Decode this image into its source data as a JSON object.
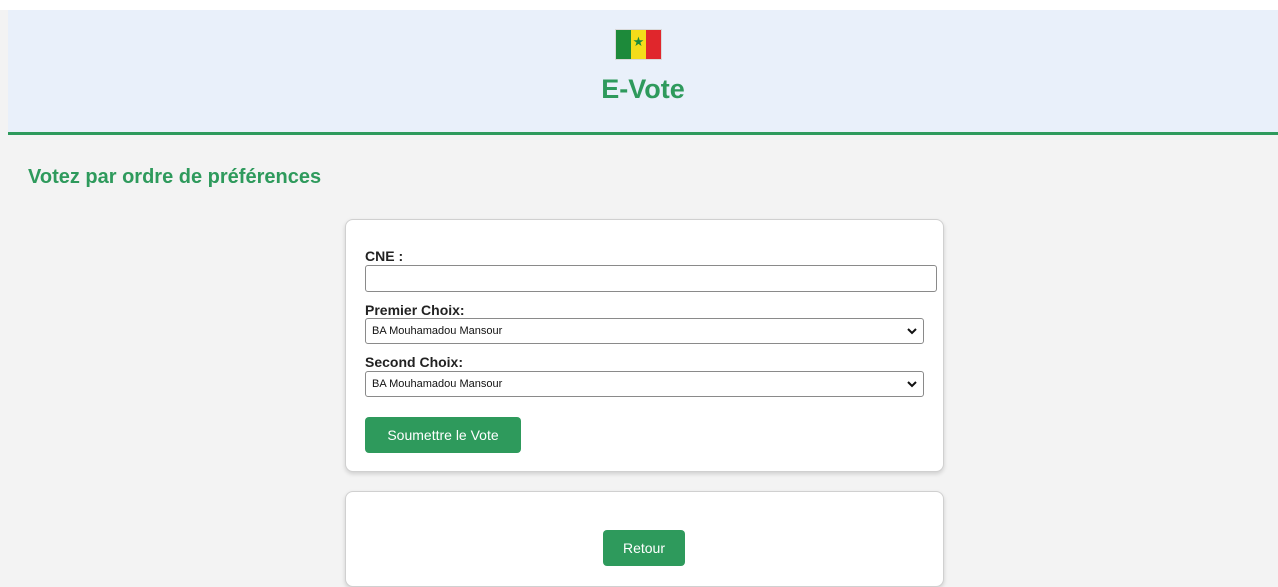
{
  "header": {
    "flag_icon": "senegal-flag",
    "flag_star": "★",
    "title": "E-Vote"
  },
  "page": {
    "heading": "Votez par ordre de préférences"
  },
  "form": {
    "cne_label": "CNE :",
    "cne_value": "",
    "first_choice_label": "Premier Choix:",
    "first_choice_value": "BA Mouhamadou Mansour",
    "second_choice_label": "Second Choix:",
    "second_choice_value": "BA Mouhamadou Mansour",
    "submit_label": "Soumettre le Vote"
  },
  "back": {
    "label": "Retour"
  },
  "colors": {
    "accent": "#2e9a5c",
    "header_bg": "#e9f0fa",
    "page_bg": "#f3f3f3"
  }
}
